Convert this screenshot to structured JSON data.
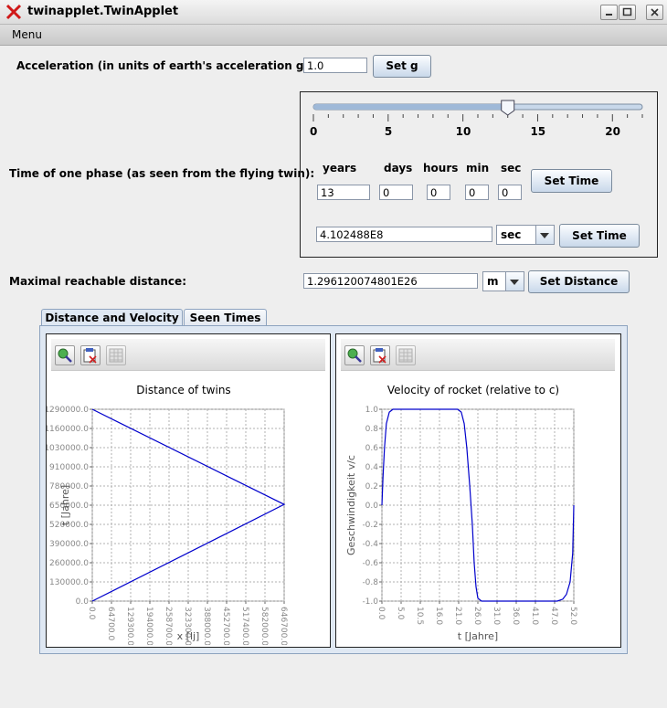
{
  "window": {
    "title": "twinapplet.TwinApplet"
  },
  "menu": {
    "label": "Menu"
  },
  "acceleration": {
    "label": "Acceleration (in units of earth's acceleration g):",
    "value": "1.0",
    "button": "Set g"
  },
  "phase": {
    "label": "Time of one phase (as seen from the flying twin):",
    "slider": {
      "ticks": [
        "0",
        "5",
        "10",
        "15",
        "20"
      ],
      "value": 13,
      "max": 22
    },
    "units": [
      "years",
      "days",
      "hours",
      "min",
      "sec"
    ],
    "values": [
      "13",
      "0",
      "0",
      "0",
      "0"
    ],
    "set_time_button": "Set Time",
    "seconds_value": "4.102488E8",
    "seconds_unit": "sec",
    "set_time_button_2": "Set Time"
  },
  "distance": {
    "label": "Maximal reachable distance:",
    "value": "1.296120074801E26",
    "unit": "m",
    "button": "Set Distance"
  },
  "tabs": {
    "active": "Distance and Velocity",
    "other": "Seen Times"
  },
  "colors": {
    "series": "#0000cc",
    "grid": "#b0b0b0"
  },
  "chart_data": [
    {
      "type": "line",
      "title": "Distance of twins",
      "xlabel": "x [lj]",
      "ylabel": "t [Jahre]",
      "x_ticks": [
        "0.0",
        "64700.0",
        "129300.0",
        "194000.0",
        "258700.0",
        "323300.0",
        "388000.0",
        "452700.0",
        "517400.0",
        "582000.0",
        "646700.0"
      ],
      "y_ticks": [
        "0.0",
        "130000.0",
        "260000.0",
        "390000.0",
        "520000.0",
        "650000.0",
        "780000.0",
        "910000.0",
        "1030000.0",
        "1160000.0",
        "1290000.0"
      ],
      "xlim": [
        0,
        646700
      ],
      "ylim": [
        0,
        1290000
      ],
      "series": [
        {
          "x": [
            0,
            646700,
            0
          ],
          "y": [
            0,
            650000,
            1290000
          ]
        }
      ]
    },
    {
      "type": "line",
      "title": "Velocity of rocket (relative to c)",
      "xlabel": "t [Jahre]",
      "ylabel": "Geschwindigkeit v/c",
      "x_ticks": [
        "0.0",
        "5.0",
        "10.5",
        "16.0",
        "21.0",
        "26.0",
        "31.0",
        "36.0",
        "41.0",
        "47.0",
        "52.0"
      ],
      "y_ticks": [
        "-1.0",
        "-0.8",
        "-0.6",
        "-0.4",
        "-0.2",
        "0.0",
        "0.2",
        "0.4",
        "0.6",
        "0.8",
        "1.0"
      ],
      "xlim": [
        0,
        52
      ],
      "ylim": [
        -1,
        1
      ],
      "series": [
        {
          "x": [
            0,
            0.3,
            0.7,
            1.2,
            2,
            3,
            20.5,
            21.5,
            22.3,
            23,
            23.8,
            24.5,
            25,
            25.5,
            26,
            27,
            28,
            29,
            46,
            47.5,
            49,
            50,
            51,
            51.7,
            52
          ],
          "y": [
            0,
            0.3,
            0.6,
            0.85,
            0.97,
            1.0,
            1.0,
            0.97,
            0.85,
            0.6,
            0.2,
            -0.2,
            -0.6,
            -0.85,
            -0.97,
            -1.0,
            -1.0,
            -1.0,
            -1.0,
            -1.0,
            -0.98,
            -0.93,
            -0.8,
            -0.5,
            0
          ]
        }
      ]
    }
  ]
}
